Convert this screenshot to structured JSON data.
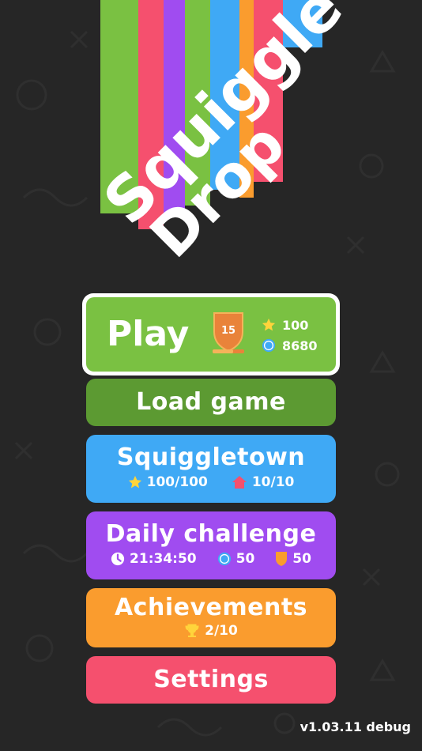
{
  "logo": {
    "word1": "Squiggle",
    "word2": "Drop"
  },
  "play": {
    "label": "Play",
    "level": "15",
    "stars": "100",
    "coins": "8680"
  },
  "load": {
    "label": "Load game"
  },
  "town": {
    "label": "Squiggletown",
    "stars": "100/100",
    "houses": "10/10"
  },
  "daily": {
    "label": "Daily challenge",
    "timer": "21:34:50",
    "coins": "50",
    "shields": "50"
  },
  "ach": {
    "label": "Achievements",
    "trophies": "2/10"
  },
  "settings": {
    "label": "Settings"
  },
  "version": "v1.03.11 debug",
  "colors": {
    "play": "#7ac142",
    "load": "#5c9a32",
    "town": "#3fa9f5",
    "daily": "#a04cf0",
    "ach": "#fa9c2e",
    "settings": "#f5506e",
    "coin": "#3fa9f5",
    "star": "#ffd43b"
  }
}
